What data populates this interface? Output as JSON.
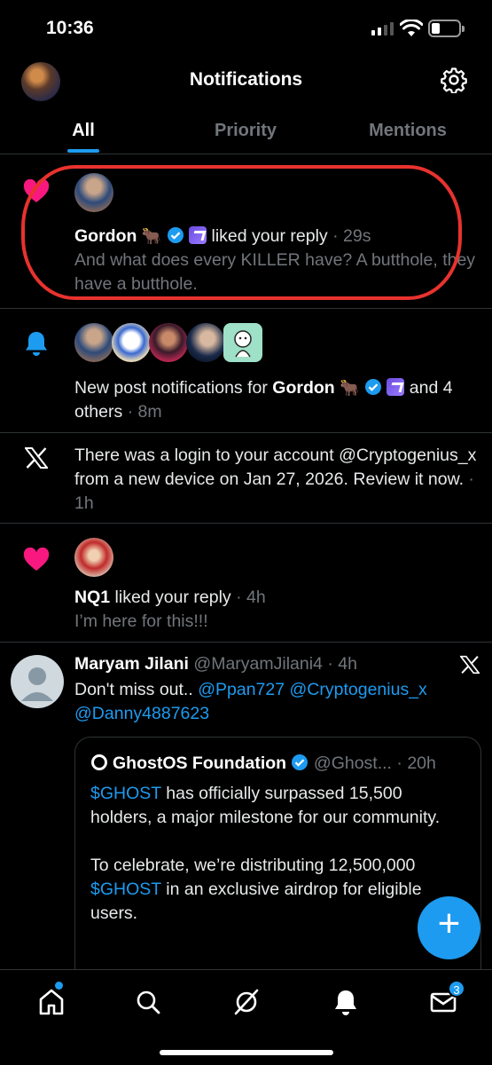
{
  "status": {
    "time": "10:36"
  },
  "header": {
    "title": "Notifications"
  },
  "tabs": [
    {
      "label": "All",
      "active": true
    },
    {
      "label": "Priority",
      "active": false
    },
    {
      "label": "Mentions",
      "active": false
    }
  ],
  "notifications": [
    {
      "type": "like",
      "icon": "heart-icon",
      "name": "Gordon",
      "name_emoji": "🐂",
      "action": "liked your reply",
      "time": "29s",
      "text": "And what does every KILLER have? A butthole, they have a butthole."
    },
    {
      "type": "new-post",
      "icon": "bell-icon",
      "prefix": "New post notifications for",
      "name": "Gordon",
      "name_emoji": "🐂",
      "suffix": "and 4 others",
      "time": "8m"
    },
    {
      "type": "security",
      "icon": "x-logo-icon",
      "text": "There was a login to your account @Cryptogenius_x from a new device on Jan 27, 2026. Review it now.",
      "time": "1h"
    },
    {
      "type": "like",
      "icon": "heart-icon",
      "name": "NQ1",
      "action": "liked your reply",
      "time": "4h",
      "text": "I’m here for this!!!"
    },
    {
      "type": "post",
      "name": "Maryam Jilani",
      "handle": "@MaryamJilani4",
      "time": "4h",
      "text": "Don't miss out..",
      "mentions": [
        "@Ppan727",
        "@Cryptogenius_x",
        "@Danny4887623"
      ],
      "quote": {
        "name": "GhostOS Foundation",
        "handle": "@Ghost...",
        "time": "20h",
        "p1_ticker": "$GHOST",
        "p1_rest": "has officially surpassed 15,500 holders, a major milestone for our community.",
        "p2_start": "To celebrate, we’re distributing 12,500,000",
        "p2_ticker": "$GHOST",
        "p2_rest": "in an exclusive airdrop for eligible users."
      }
    }
  ],
  "fab": {
    "label": "+"
  },
  "bottom_nav": {
    "messages_badge": "3",
    "items": [
      "home-icon",
      "search-icon",
      "grok-icon",
      "notifications-icon",
      "messages-icon"
    ]
  },
  "colors": {
    "accent": "#1d9bf0",
    "like": "#f91880",
    "highlight": "#e8322e",
    "muted": "#71767b"
  }
}
